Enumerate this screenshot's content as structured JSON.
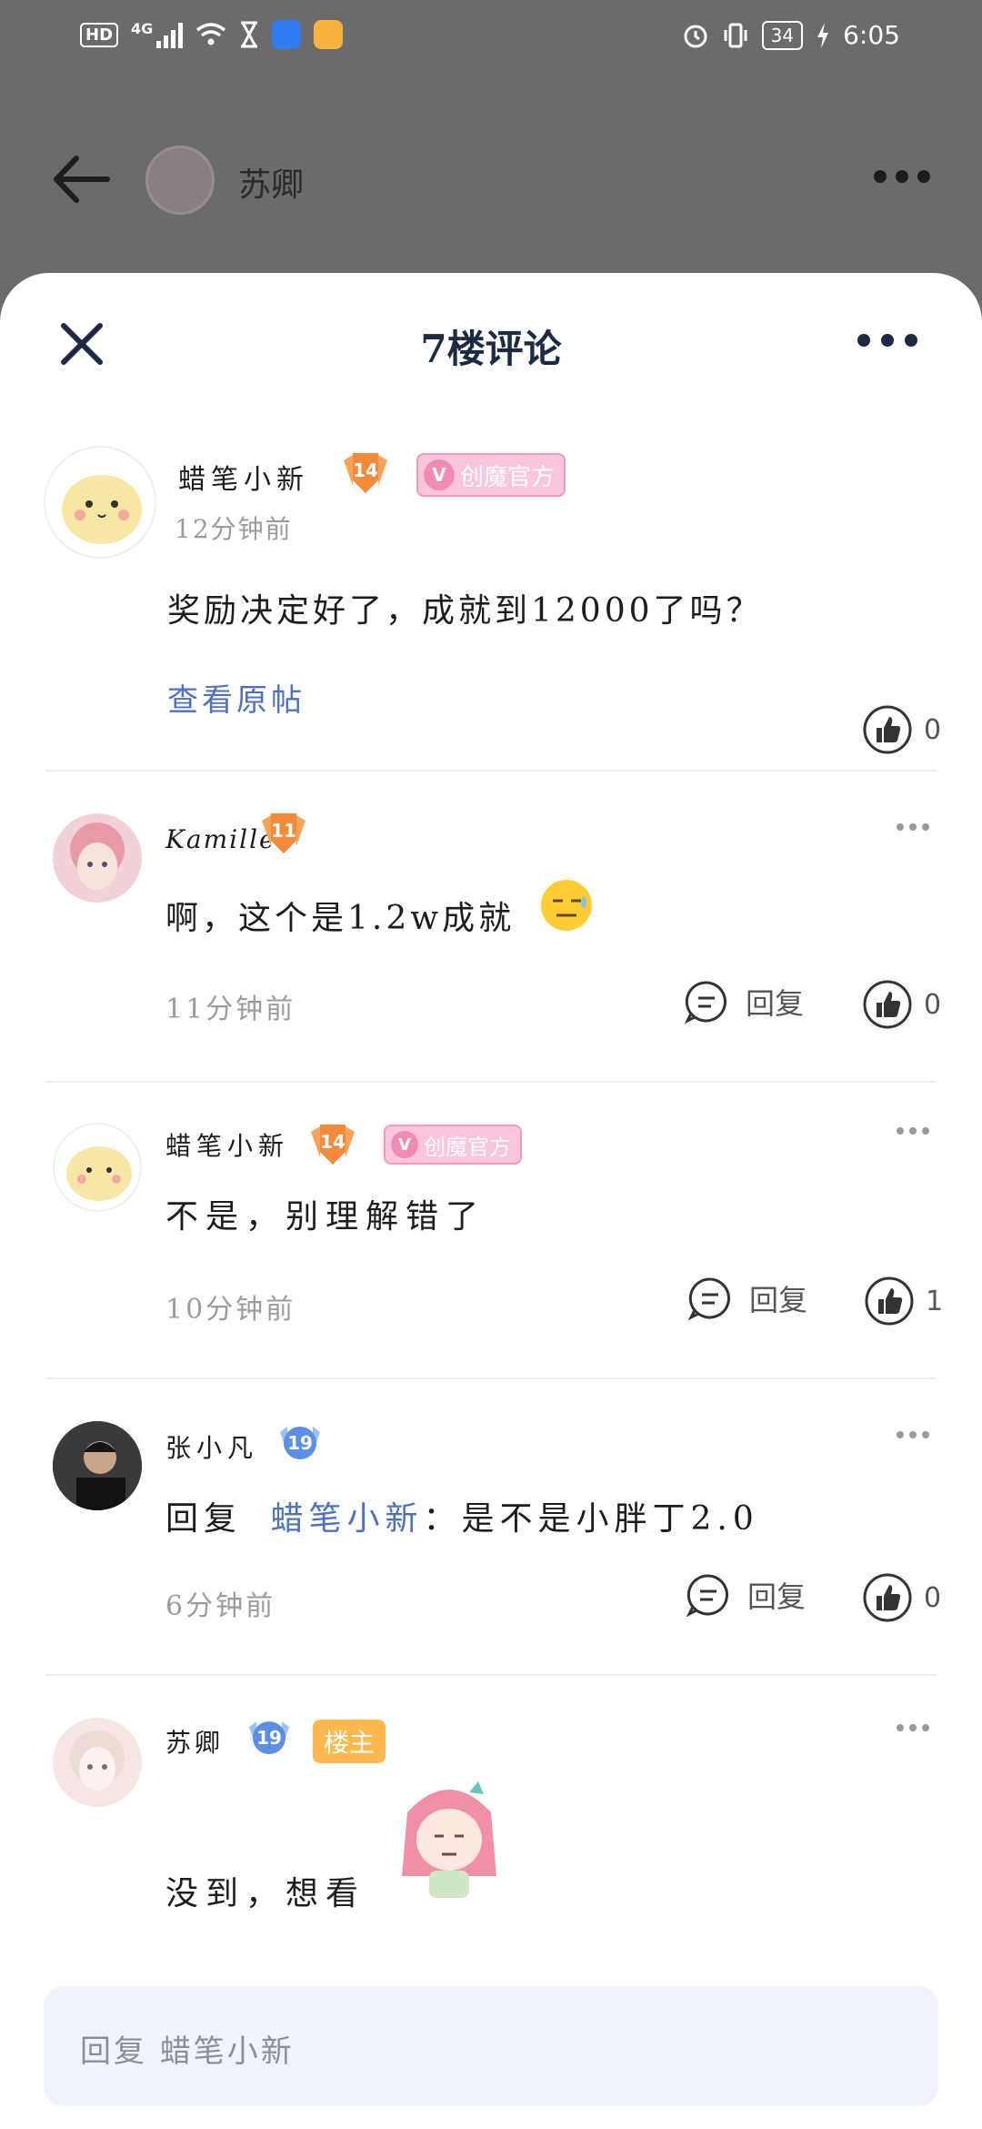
{
  "status_bar": {
    "hd": "HD",
    "network": "4G",
    "battery": "34",
    "time": "6:05"
  },
  "page": {
    "author_name": "苏卿"
  },
  "sheet": {
    "title": "7楼评论"
  },
  "comments": [
    {
      "user": "蜡笔小新",
      "level": "14",
      "badge": "创魔官方",
      "time": "12分钟前",
      "text": "奖励决定好了，成就到12000了吗？",
      "action": "查看原帖",
      "likes": "0"
    },
    {
      "user": "Kamille",
      "level": "11",
      "text": "啊，这个是1.2w成就",
      "time": "11分钟前",
      "reply_label": "回复",
      "likes": "0"
    },
    {
      "user": "蜡笔小新",
      "level": "14",
      "badge": "创魔官方",
      "text": "不是，别理解错了",
      "time": "10分钟前",
      "reply_label": "回复",
      "likes": "1"
    },
    {
      "user": "张小凡",
      "level": "19",
      "reply_prefix": "回复",
      "reply_to": "蜡笔小新",
      "text": "：是不是小胖丁2.0",
      "time": "6分钟前",
      "reply_label": "回复",
      "likes": "0"
    },
    {
      "user": "苏卿",
      "level": "19",
      "badge": "楼主",
      "text": "没到，想看"
    }
  ],
  "input": {
    "placeholder": "回复 蜡笔小新"
  },
  "colors": {
    "link": "#4e70c0",
    "level_orange": "#f58a3a",
    "level_blue": "#5b8fe6",
    "official_badge": "#fbc6dc",
    "owner_badge": "#ffb94d"
  }
}
